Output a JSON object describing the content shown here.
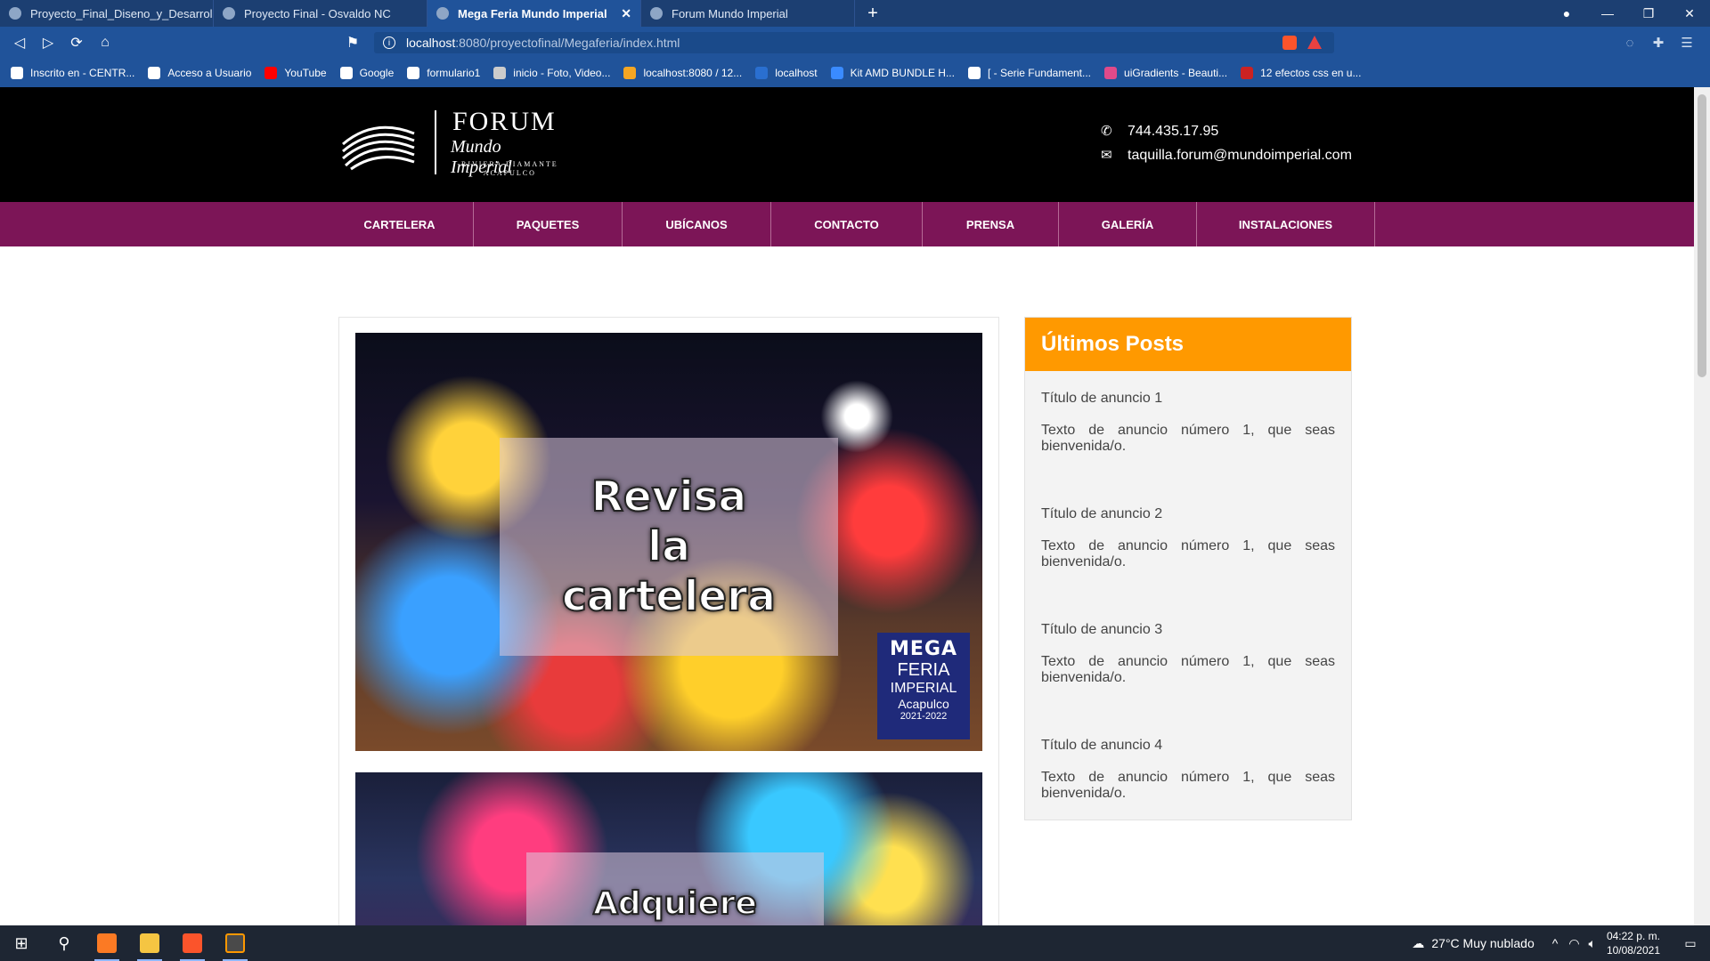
{
  "browser": {
    "tabs": [
      {
        "title": "Proyecto_Final_Diseno_y_Desarrollo_C",
        "active": false
      },
      {
        "title": "Proyecto Final - Osvaldo NC",
        "active": false
      },
      {
        "title": "Mega Feria Mundo Imperial",
        "active": true
      },
      {
        "title": "Forum Mundo Imperial",
        "active": false
      }
    ],
    "new_tab": "+",
    "close_tab": "✕",
    "url_host": "localhost",
    "url_path": ":8080/proyectofinal/Megaferia/index.html",
    "bookmarks": [
      {
        "label": "Inscrito en - CENTR...",
        "color": "#ffffff"
      },
      {
        "label": "Acceso a Usuario",
        "color": "#ffffff"
      },
      {
        "label": "YouTube",
        "color": "#ff0000"
      },
      {
        "label": "Google",
        "color": "#ffffff"
      },
      {
        "label": "formulario1",
        "color": "#ffffff"
      },
      {
        "label": "inicio - Foto, Video...",
        "color": "#cccccc"
      },
      {
        "label": "localhost:8080 / 12...",
        "color": "#f5a623"
      },
      {
        "label": "localhost",
        "color": "#2a6fd0"
      },
      {
        "label": "Kit AMD BUNDLE H...",
        "color": "#3a8bff"
      },
      {
        "label": "[ - Serie Fundament...",
        "color": "#ffffff"
      },
      {
        "label": "uiGradients - Beauti...",
        "color": "#e04a8a"
      },
      {
        "label": "12 efectos css en u...",
        "color": "#cc2222"
      }
    ]
  },
  "site": {
    "logo": {
      "name": "FORUM",
      "sub": "Mundo Imperial",
      "tag1": "RIVIERA DIAMANTE",
      "tag2": "ACAPULCO"
    },
    "phone": "744.435.17.95",
    "email": "taquilla.forum@mundoimperial.com",
    "menu": [
      "CARTELERA",
      "PAQUETES",
      "UBÍCANOS",
      "CONTACTO",
      "PRENSA",
      "GALERÍA",
      "INSTALACIONES"
    ],
    "promo1": {
      "line1": "Revisa",
      "line2": "la",
      "line3": "cartelera"
    },
    "badge": {
      "l1": "MEGA",
      "l2": "FERIA",
      "l3": "IMPERIAL",
      "l4": "Acapulco",
      "l5": "2021-2022"
    },
    "promo2": {
      "line1": "Adquiere"
    },
    "sidebar": {
      "title": "Últimos Posts",
      "posts": [
        {
          "title": "Título de anuncio 1",
          "body": "Texto de anuncio número 1, que seas bienvenida/o."
        },
        {
          "title": "Título de anuncio 2",
          "body": "Texto de anuncio número 1, que seas bienvenida/o."
        },
        {
          "title": "Título de anuncio 3",
          "body": "Texto de anuncio número 1, que seas bienvenida/o."
        },
        {
          "title": "Título de anuncio 4",
          "body": "Texto de anuncio número 1, que seas bienvenida/o."
        }
      ]
    }
  },
  "taskbar": {
    "weather": "27°C  Muy nublado",
    "time": "04:22 p. m.",
    "date": "10/08/2021"
  },
  "colors": {
    "menu_bg": "#7c1557",
    "sidebar_header": "#ff9900",
    "browser_chrome": "#20539a"
  }
}
